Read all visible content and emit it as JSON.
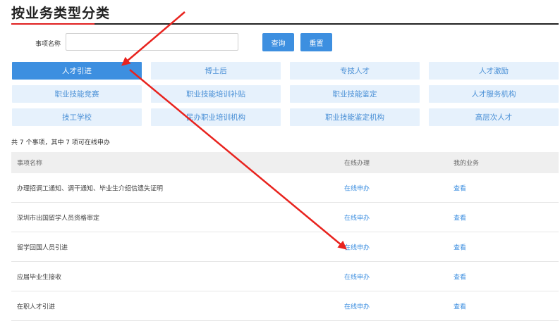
{
  "page": {
    "title": "按业务类型分类"
  },
  "search": {
    "label": "事项名称",
    "value": "",
    "placeholder": "",
    "query_label": "查询",
    "reset_label": "重置"
  },
  "categories": [
    {
      "label": "人才引进",
      "active": true
    },
    {
      "label": "博士后",
      "active": false
    },
    {
      "label": "专技人才",
      "active": false
    },
    {
      "label": "人才激励",
      "active": false
    },
    {
      "label": "职业技能竞赛",
      "active": false
    },
    {
      "label": "职业技能培训补贴",
      "active": false
    },
    {
      "label": "职业技能鉴定",
      "active": false
    },
    {
      "label": "人才服务机构",
      "active": false
    },
    {
      "label": "技工学校",
      "active": false
    },
    {
      "label": "民办职业培训机构",
      "active": false
    },
    {
      "label": "职业技能鉴定机构",
      "active": false
    },
    {
      "label": "高层次人才",
      "active": false
    }
  ],
  "summary": "共 7 个事项，其中 7 项可在线申办",
  "table": {
    "headers": [
      "事项名称",
      "在线办理",
      "我的业务"
    ],
    "rows": [
      {
        "name": "办理招调工通知、调干通知、毕业生介绍信遗失证明",
        "online": "在线申办",
        "mine": "查看"
      },
      {
        "name": "深圳市出国留学人员资格审定",
        "online": "在线申办",
        "mine": "查看"
      },
      {
        "name": "留学回国人员引进",
        "online": "在线申办",
        "mine": "查看"
      },
      {
        "name": "应届毕业生接收",
        "online": "在线申办",
        "mine": "查看"
      },
      {
        "name": "在职人才引进",
        "online": "在线申办",
        "mine": "查看"
      }
    ]
  },
  "colors": {
    "accent": "#3d8fe0",
    "category_bg": "#e6f1fc",
    "annotation_arrow": "#e8231e"
  },
  "annotations": [
    "arrow-icon",
    "arrow-icon"
  ]
}
